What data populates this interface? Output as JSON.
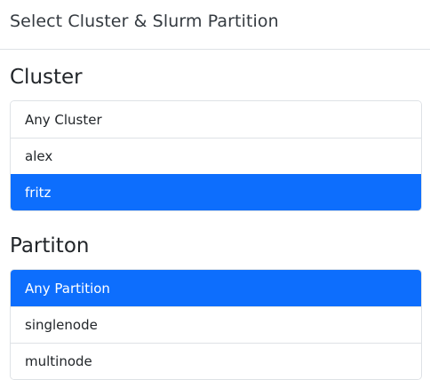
{
  "dialog": {
    "title": "Select Cluster & Slurm Partition"
  },
  "cluster": {
    "heading": "Cluster",
    "items": [
      {
        "label": "Any Cluster",
        "active": false
      },
      {
        "label": "alex",
        "active": false
      },
      {
        "label": "fritz",
        "active": true
      }
    ]
  },
  "partition": {
    "heading": "Partiton",
    "items": [
      {
        "label": "Any Partition",
        "active": true
      },
      {
        "label": "singlenode",
        "active": false
      },
      {
        "label": "multinode",
        "active": false
      }
    ]
  },
  "colors": {
    "active_bg": "#0d6efd",
    "active_text": "#ffffff",
    "border": "#dee2e6"
  }
}
